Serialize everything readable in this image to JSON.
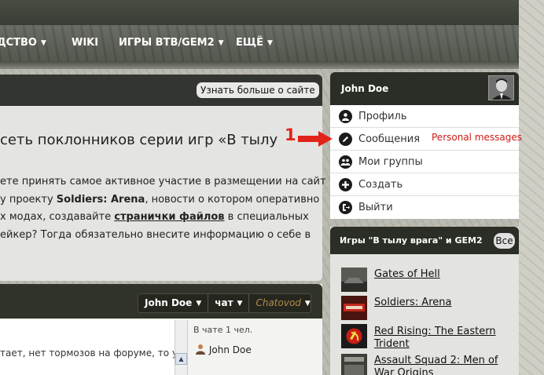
{
  "nav": {
    "items": [
      {
        "label": "ДСТВО",
        "has_caret": true
      },
      {
        "label": "WIKI",
        "has_caret": false
      },
      {
        "label": "ИГРЫ ВТВ/GEM2",
        "has_caret": true
      },
      {
        "label": "ЕЩЁ",
        "has_caret": true
      }
    ]
  },
  "intro": {
    "learn_more_label": "Узнать больше о сайте",
    "title": "сеть поклонников серии игр «В тылу",
    "text_line1": "ете принять самое активное участие в размещении на сайт",
    "text_line2_pre": "у проекту ",
    "text_line2_bold": "Soldiers: Arena",
    "text_line2_post": ", новости о котором оперативно",
    "text_line3_pre": "х модах, создавайте ",
    "text_line3_link": "странички файлов",
    "text_line3_post": " в специальных",
    "text_line4": "ейкер? Тогда обязательно внесите информацию о себе в"
  },
  "chat": {
    "tabs": [
      "John Doe",
      "чат",
      "Chatovod"
    ],
    "message_fragment": "тает, нет тормозов на форуме, то у",
    "users_label": "В чате 1 чел.",
    "user_name": "John Doe"
  },
  "user_menu": {
    "name": "John Doe",
    "items": [
      {
        "label": "Профиль",
        "icon": "user-icon"
      },
      {
        "label": "Сообщения",
        "icon": "pencil-icon"
      },
      {
        "label": "Мои группы",
        "icon": "group-icon"
      },
      {
        "label": "Создать",
        "icon": "plus-icon"
      },
      {
        "label": "Выйти",
        "icon": "logout-icon"
      }
    ]
  },
  "annotation": {
    "number": "1",
    "text": "Personal messages",
    "color": "#e2231a"
  },
  "games": {
    "title": "Игры \"В тылу врага\" и GEM2",
    "all_label": "Все",
    "items": [
      {
        "name": "Gates of Hell"
      },
      {
        "name": "Soldiers: Arena"
      },
      {
        "name": "Red Rising: The Eastern Trident"
      },
      {
        "name": "Assault Squad 2: Men of War Origins"
      }
    ]
  }
}
